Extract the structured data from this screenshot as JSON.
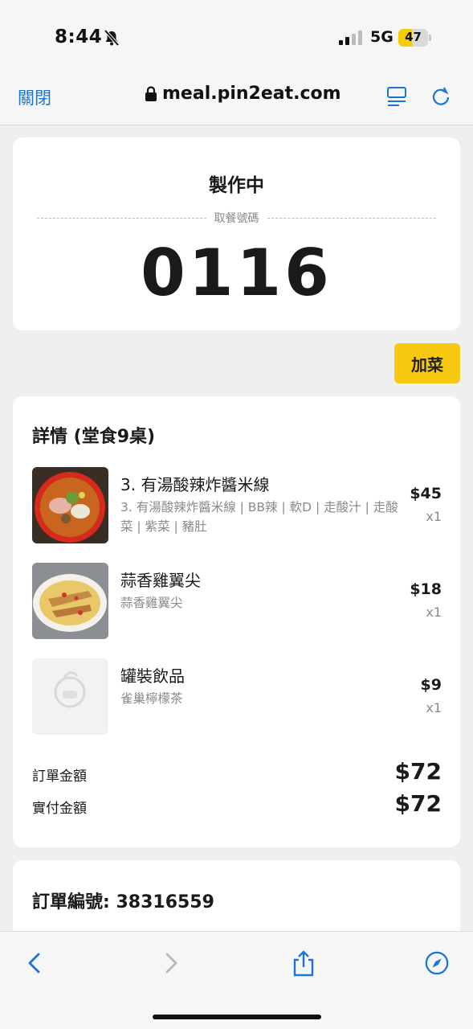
{
  "status_bar": {
    "time": "8:44",
    "network": "5G",
    "battery": 47
  },
  "browser": {
    "close_label": "關閉",
    "url": "meal.pin2eat.com"
  },
  "order_status": {
    "title": "製作中",
    "pickup_label": "取餐號碼",
    "pickup_number": "0116"
  },
  "add_dish_label": "加菜",
  "details": {
    "title": "詳情 (堂食9桌)",
    "items": [
      {
        "name": "3. 有湯酸辣炸醬米線",
        "desc": "3. 有湯酸辣炸醬米線 | BB辣 | 軟D | 走酸汁 | 走酸菜 | 紫菜 | 豬肚",
        "price": "$45",
        "qty": "x1"
      },
      {
        "name": "蒜香雞翼尖",
        "desc": "蒜香雞翼尖",
        "price": "$18",
        "qty": "x1"
      },
      {
        "name": "罐裝飲品",
        "desc": "雀巢檸檬茶",
        "price": "$9",
        "qty": "x1"
      }
    ],
    "order_amount_label": "訂單金額",
    "order_amount": "$72",
    "paid_amount_label": "實付金額",
    "paid_amount": "$72"
  },
  "order_number_label": "訂單編號: 38316559",
  "colors": {
    "accent": "#f7c910",
    "link": "#1877d6"
  }
}
